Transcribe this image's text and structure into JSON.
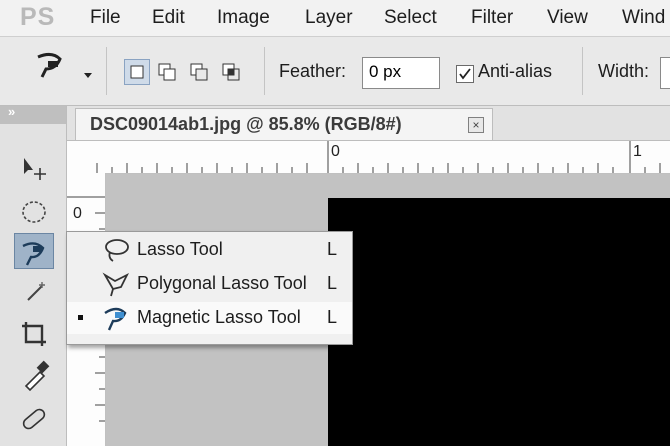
{
  "app": {
    "logo": "PS"
  },
  "menu": [
    "File",
    "Edit",
    "Image",
    "Layer",
    "Select",
    "Filter",
    "View",
    "Wind"
  ],
  "options_bar": {
    "feather_label": "Feather:",
    "feather_value": "0 px",
    "anti_alias_label": "Anti-alias",
    "anti_alias_checked": true,
    "width_label": "Width:"
  },
  "panel": {
    "collapse_glyph": "»"
  },
  "document": {
    "tab_title": "DSC09014ab1.jpg @ 85.8% (RGB/8#)",
    "close_glyph": "×"
  },
  "rulers": {
    "h_ticks": [
      "0",
      "1"
    ],
    "v_ticks": [
      "0"
    ]
  },
  "tools": [
    "move-icon",
    "elliptical-marquee-icon",
    "magnetic-lasso-icon",
    "magic-wand-icon",
    "crop-icon",
    "eyedropper-icon",
    "spot-healing-icon"
  ],
  "flyout": {
    "items": [
      {
        "label": "Lasso Tool",
        "shortcut": "L",
        "icon": "lasso-icon",
        "selected": false
      },
      {
        "label": "Polygonal Lasso Tool",
        "shortcut": "L",
        "icon": "polygonal-lasso-icon",
        "selected": false
      },
      {
        "label": "Magnetic Lasso Tool",
        "shortcut": "L",
        "icon": "magnetic-lasso-icon",
        "selected": true
      }
    ]
  },
  "colors": {
    "canvas_bg": "#c2c2c2",
    "image": "#000000",
    "active_tool_bg": "#9fb3c8",
    "mode_active": "#cfdbe9"
  }
}
